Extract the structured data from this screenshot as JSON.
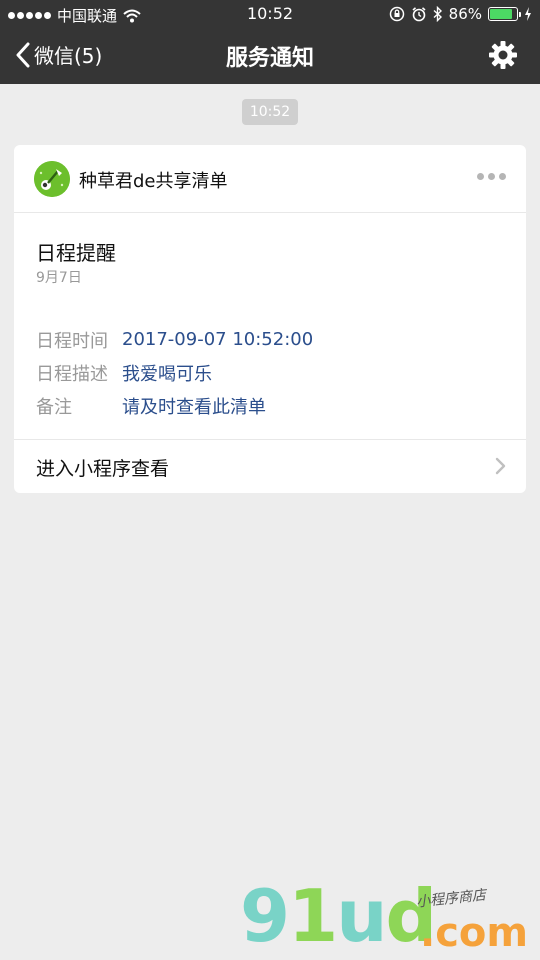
{
  "status_bar": {
    "carrier": "中国联通",
    "time": "10:52",
    "battery_percent": "86%",
    "battery_level": 0.86
  },
  "nav": {
    "back_label": "微信(5)",
    "title": "服务通知"
  },
  "timestamp": "10:52",
  "card": {
    "app_name": "种草君de共享清单",
    "title": "日程提醒",
    "date": "9月7日",
    "rows": [
      {
        "label": "日程时间",
        "value": "2017-09-07 10:52:00"
      },
      {
        "label": "日程描述",
        "value": "我爱喝可乐"
      },
      {
        "label": "备注",
        "value": "请及时查看此清单"
      }
    ],
    "footer_label": "进入小程序查看"
  },
  "watermark": {
    "brand": "91ud",
    "suffix": ".com",
    "tagline": "小程序商店"
  },
  "colors": {
    "nav_bg": "#353535",
    "page_bg": "#ededed",
    "value_text": "#2b4e8c",
    "battery": "#4cd964"
  },
  "icons": [
    "signal-dots-icon",
    "wifi-icon",
    "lock-rotation-icon",
    "alarm-icon",
    "bluetooth-icon",
    "battery-icon",
    "charging-icon",
    "back-chevron-icon",
    "gear-icon",
    "more-dots-icon",
    "chevron-right-icon"
  ]
}
